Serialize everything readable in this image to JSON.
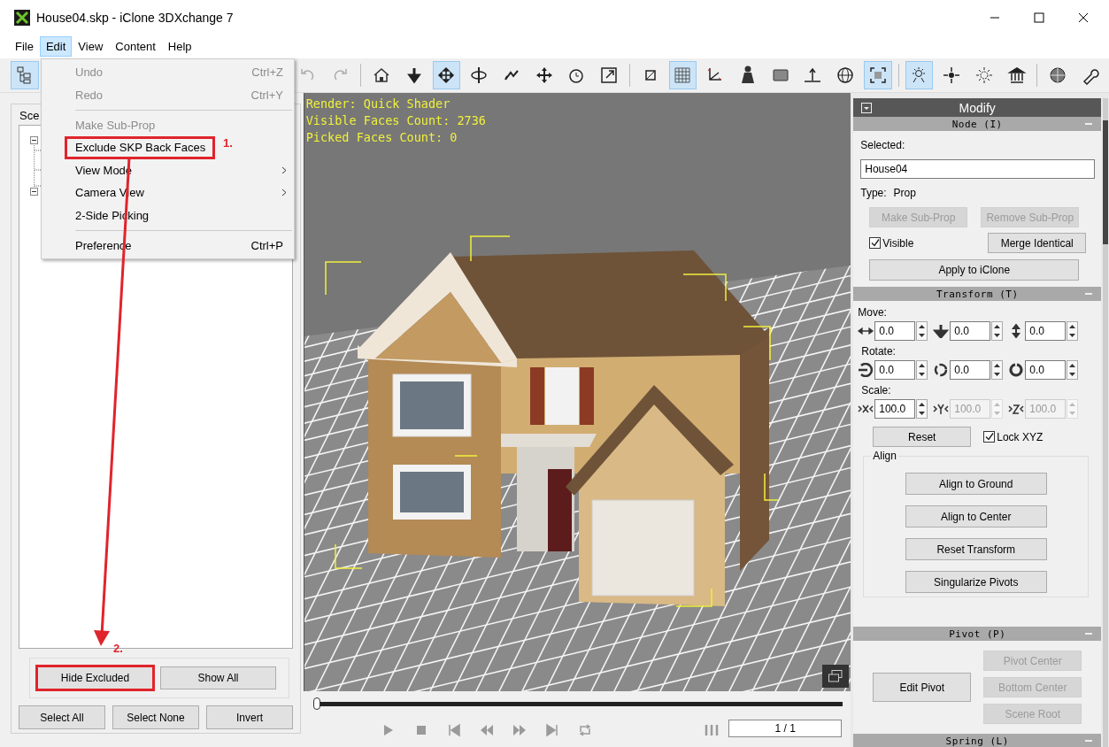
{
  "window": {
    "title": "House04.skp - iClone 3DXchange 7"
  },
  "menu_bar": [
    {
      "label": "File",
      "selected": false
    },
    {
      "label": "Edit",
      "selected": true
    },
    {
      "label": "View",
      "selected": false
    },
    {
      "label": "Content",
      "selected": false
    },
    {
      "label": "Help",
      "selected": false
    }
  ],
  "toolbar_buttons": [
    {
      "selected": true
    },
    {
      "selected": false
    },
    {
      "selected": false
    },
    {
      "selected": false
    },
    {
      "selected": false
    },
    {
      "selected": true
    },
    {
      "selected": false
    },
    {
      "selected": false
    },
    {
      "selected": false
    },
    {
      "selected": false
    },
    {
      "selected": false
    },
    {
      "selected": false
    },
    {
      "selected": true
    },
    {
      "selected": false
    },
    {
      "selected": false
    },
    {
      "selected": false
    },
    {
      "selected": false
    },
    {
      "selected": false
    },
    {
      "selected": true
    },
    {
      "selected": true
    },
    {
      "selected": false
    },
    {
      "selected": false
    },
    {
      "selected": false
    },
    {
      "selected": false
    },
    {
      "selected": false
    }
  ],
  "edit_menu": {
    "items": [
      {
        "kind": "item",
        "label": "Undo",
        "shortcut": "Ctrl+Z",
        "disabled": true,
        "submenu": false,
        "annotated": false
      },
      {
        "kind": "item",
        "label": "Redo",
        "shortcut": "Ctrl+Y",
        "disabled": true,
        "submenu": false,
        "annotated": false
      },
      {
        "kind": "separator"
      },
      {
        "kind": "item",
        "label": "Make Sub-Prop",
        "disabled": true,
        "submenu": false,
        "annotated": false
      },
      {
        "kind": "item",
        "label": "Exclude SKP Back Faces",
        "disabled": false,
        "submenu": false,
        "annotated": true
      },
      {
        "kind": "item",
        "label": "View Mode",
        "disabled": false,
        "submenu": true,
        "annotated": false
      },
      {
        "kind": "item",
        "label": "Camera View",
        "disabled": false,
        "submenu": true,
        "annotated": false
      },
      {
        "kind": "item",
        "label": "2-Side Picking",
        "disabled": false,
        "submenu": false,
        "annotated": false
      },
      {
        "kind": "separator"
      },
      {
        "kind": "item",
        "label": "Preference",
        "shortcut": "Ctrl+P",
        "disabled": false,
        "submenu": false,
        "annotated": false
      }
    ]
  },
  "scene_panel": {
    "group_label": "Sce",
    "tree": [
      {
        "expanded": true
      },
      {
        "expanded": true
      }
    ],
    "visibility_buttons": [
      {
        "label": "Hide Excluded",
        "annotated": true
      },
      {
        "label": "Show All",
        "annotated": false
      }
    ],
    "selection_buttons": [
      {
        "label": "Select All"
      },
      {
        "label": "Select None"
      },
      {
        "label": "Invert"
      }
    ]
  },
  "viewport": {
    "info_lines": [
      "Render: Quick Shader",
      "Visible Faces Count: 2736",
      "Picked Faces Count: 0"
    ]
  },
  "timeline": {
    "level": 0,
    "frame": "1 / 1"
  },
  "modify_panel": {
    "title": "Modify",
    "node": {
      "title": "Node (I)",
      "selected_label": "Selected:",
      "selected_value": "House04",
      "type_label": "Type:",
      "type_value": "Prop",
      "buttons": [
        {
          "label": "Make Sub-Prop",
          "disabled": true
        },
        {
          "label": "Remove Sub-Prop",
          "disabled": true
        }
      ],
      "visible": {
        "label": "Visible",
        "checked": true
      },
      "merge_button": {
        "label": "Merge Identical",
        "disabled": false
      },
      "apply_button": {
        "label": "Apply to iClone",
        "disabled": false
      }
    },
    "transform": {
      "title": "Transform (T)",
      "groups": [
        {
          "label": "Move:",
          "fields": [
            {
              "value": "0.0",
              "disabled": false
            },
            {
              "value": "0.0",
              "disabled": false
            },
            {
              "value": "0.0",
              "disabled": false
            }
          ]
        },
        {
          "label": "Rotate:",
          "fields": [
            {
              "value": "0.0",
              "disabled": false
            },
            {
              "value": "0.0",
              "disabled": false
            },
            {
              "value": "0.0",
              "disabled": false
            }
          ]
        },
        {
          "label": "Scale:",
          "fields": [
            {
              "value": "100.0",
              "disabled": false
            },
            {
              "value": "100.0",
              "disabled": true
            },
            {
              "value": "100.0",
              "disabled": true
            }
          ]
        }
      ],
      "reset_button": "Reset",
      "lock": {
        "label": "Lock XYZ",
        "checked": true
      },
      "align": {
        "label": "Align",
        "buttons": [
          "Align to Ground",
          "Align to Center",
          "Reset Transform",
          "Singularize Pivots"
        ]
      }
    },
    "pivot": {
      "title": "Pivot (P)",
      "edit_button": "Edit Pivot",
      "buttons": [
        {
          "label": "Pivot Center",
          "disabled": true
        },
        {
          "label": "Bottom Center",
          "disabled": true
        },
        {
          "label": "Scene Root",
          "disabled": true
        }
      ]
    },
    "spring": {
      "title": "Spring (L)"
    }
  },
  "annotations": [
    {
      "label": "1."
    },
    {
      "label": "2."
    }
  ]
}
